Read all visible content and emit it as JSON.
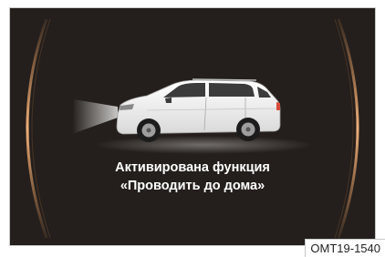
{
  "display": {
    "message_line1": "Активирована функция",
    "message_line2": "«Проводить до дома»",
    "figure_code": "OMT19-1540",
    "colors": {
      "screen_background": "#241f1c",
      "bezel_glow": "#e89a5c",
      "text": "#ffffff"
    },
    "icons": {
      "vehicle": "suv-side-view-icon",
      "headlight_beam": "headlight-beam-icon"
    }
  }
}
